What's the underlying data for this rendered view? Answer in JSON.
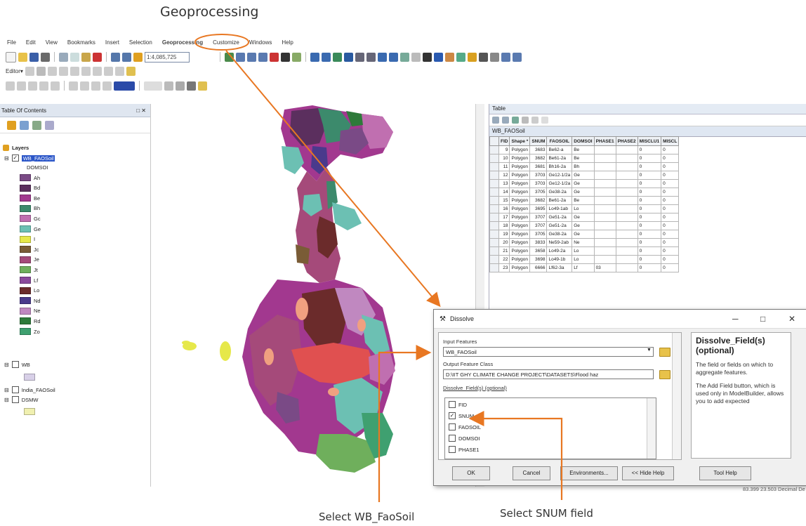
{
  "annotation": {
    "title": "Geoprocessing",
    "select_features": "Select WB_FaoSoil",
    "select_field": "Select SNUM field",
    "accent_color": "#e87722"
  },
  "menu": [
    "File",
    "Edit",
    "View",
    "Bookmarks",
    "Insert",
    "Selection",
    "Geoprocessing",
    "Customize",
    "Windows",
    "Help"
  ],
  "toolbar": {
    "scale": "1:4,085,725",
    "editor_label": "Editor▾"
  },
  "toc": {
    "title": "Table Of Contents",
    "root": "Layers",
    "layer": "WB_FAOSoil",
    "field_heading": "DOMSOI",
    "classes": [
      {
        "label": "Ah",
        "color": "#7a4a86"
      },
      {
        "label": "Bd",
        "color": "#5b2f5e"
      },
      {
        "label": "Be",
        "color": "#a2388f"
      },
      {
        "label": "Bh",
        "color": "#3c8a6c"
      },
      {
        "label": "Gc",
        "color": "#c06fb0"
      },
      {
        "label": "Ge",
        "color": "#6cc0b3"
      },
      {
        "label": "I",
        "color": "#e6e84a"
      },
      {
        "label": "Jc",
        "color": "#7a5c36"
      },
      {
        "label": "Je",
        "color": "#a54a7a"
      },
      {
        "label": "Jt",
        "color": "#6faf5c"
      },
      {
        "label": "Lf",
        "color": "#8a4a9c"
      },
      {
        "label": "Lo",
        "color": "#6b2b2b"
      },
      {
        "label": "Nd",
        "color": "#4a3a8c"
      },
      {
        "label": "Ne",
        "color": "#c088c0"
      },
      {
        "label": "Rd",
        "color": "#2e7a3a"
      },
      {
        "label": "Zo",
        "color": "#3fa070"
      }
    ],
    "other_layers": [
      "WB",
      "India_FAOSoil",
      "DSMW"
    ]
  },
  "table": {
    "window_title": "Table",
    "tab": "WB_FAOSoil",
    "columns": [
      "FID",
      "Shape *",
      "SNUM",
      "FAOSOIL",
      "DOMSOI",
      "PHASE1",
      "PHASE2",
      "MISCLU1",
      "MISCL"
    ],
    "rows": [
      [
        "9",
        "Polygon",
        "3683",
        "Be62-a",
        "Be",
        "",
        "",
        "0",
        "0"
      ],
      [
        "10",
        "Polygon",
        "3682",
        "Be61-2a",
        "Be",
        "",
        "",
        "0",
        "0"
      ],
      [
        "11",
        "Polygon",
        "3681",
        "Bh16-2a",
        "Bh",
        "",
        "",
        "0",
        "0"
      ],
      [
        "12",
        "Polygon",
        "3703",
        "Ge12-1/2a",
        "Ge",
        "",
        "",
        "0",
        "0"
      ],
      [
        "13",
        "Polygon",
        "3703",
        "Ge12-1/2a",
        "Ge",
        "",
        "",
        "0",
        "0"
      ],
      [
        "14",
        "Polygon",
        "3705",
        "Ge38-2a",
        "Ge",
        "",
        "",
        "0",
        "0"
      ],
      [
        "15",
        "Polygon",
        "3682",
        "Be61-2a",
        "Be",
        "",
        "",
        "0",
        "0"
      ],
      [
        "16",
        "Polygon",
        "3695",
        "Lo49-1ab",
        "Lo",
        "",
        "",
        "0",
        "0"
      ],
      [
        "17",
        "Polygon",
        "3707",
        "Ge51-2a",
        "Ge",
        "",
        "",
        "0",
        "0"
      ],
      [
        "18",
        "Polygon",
        "3707",
        "Ge51-2a",
        "Ge",
        "",
        "",
        "0",
        "0"
      ],
      [
        "19",
        "Polygon",
        "3705",
        "Ge38-2a",
        "Ge",
        "",
        "",
        "0",
        "0"
      ],
      [
        "20",
        "Polygon",
        "3833",
        "Ne59-2ab",
        "Ne",
        "",
        "",
        "0",
        "0"
      ],
      [
        "21",
        "Polygon",
        "3658",
        "Lo49-2a",
        "Lo",
        "",
        "",
        "0",
        "0"
      ],
      [
        "22",
        "Polygon",
        "3698",
        "Lo49-1b",
        "Lo",
        "",
        "",
        "0",
        "0"
      ],
      [
        "23",
        "Polygon",
        "6666",
        "Lf62-3a",
        "Lf",
        "03",
        "",
        "0",
        "0"
      ]
    ]
  },
  "dialog": {
    "title": "Dissolve",
    "input_label": "Input Features",
    "input_value": "WB_FAOSoil",
    "output_label": "Output Feature Class",
    "output_value": "D:\\IIT GHY CLIMATE CHANGE PROJECT\\DATASETS\\Flood haz",
    "dissolve_label": "Dissolve_Field(s) (optional)",
    "fields": [
      {
        "name": "FID",
        "checked": false
      },
      {
        "name": "SNUM",
        "checked": true
      },
      {
        "name": "FAOSOIL",
        "checked": false
      },
      {
        "name": "DOMSOI",
        "checked": false
      },
      {
        "name": "PHASE1",
        "checked": false
      }
    ],
    "buttons": {
      "ok": "OK",
      "cancel": "Cancel",
      "env": "Environments...",
      "hide": "<< Hide Help",
      "tool_help": "Tool Help"
    },
    "help_title": "Dissolve_Field(s) (optional)",
    "help_p1": "The field or fields on which to aggregate features.",
    "help_p2": "The Add Field button, which is used only in ModelBuilder, allows you to add expected"
  },
  "status": "83.399  23.503 Decimal De"
}
